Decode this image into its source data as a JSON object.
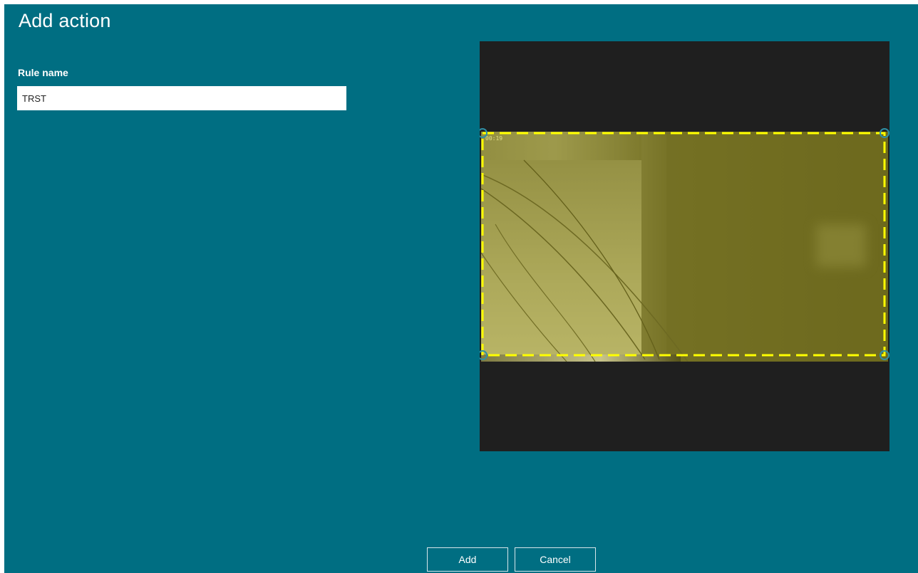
{
  "page": {
    "title": "Add action"
  },
  "rule": {
    "label": "Rule name",
    "value": "TRST"
  },
  "preview": {
    "timestamp": "00:19",
    "region_color": "#ffff00",
    "handle_color": "#2f8fa5"
  },
  "buttons": {
    "add": "Add",
    "cancel": "Cancel"
  },
  "colors": {
    "background": "#006e82",
    "preview_background": "#1f1f1f"
  }
}
